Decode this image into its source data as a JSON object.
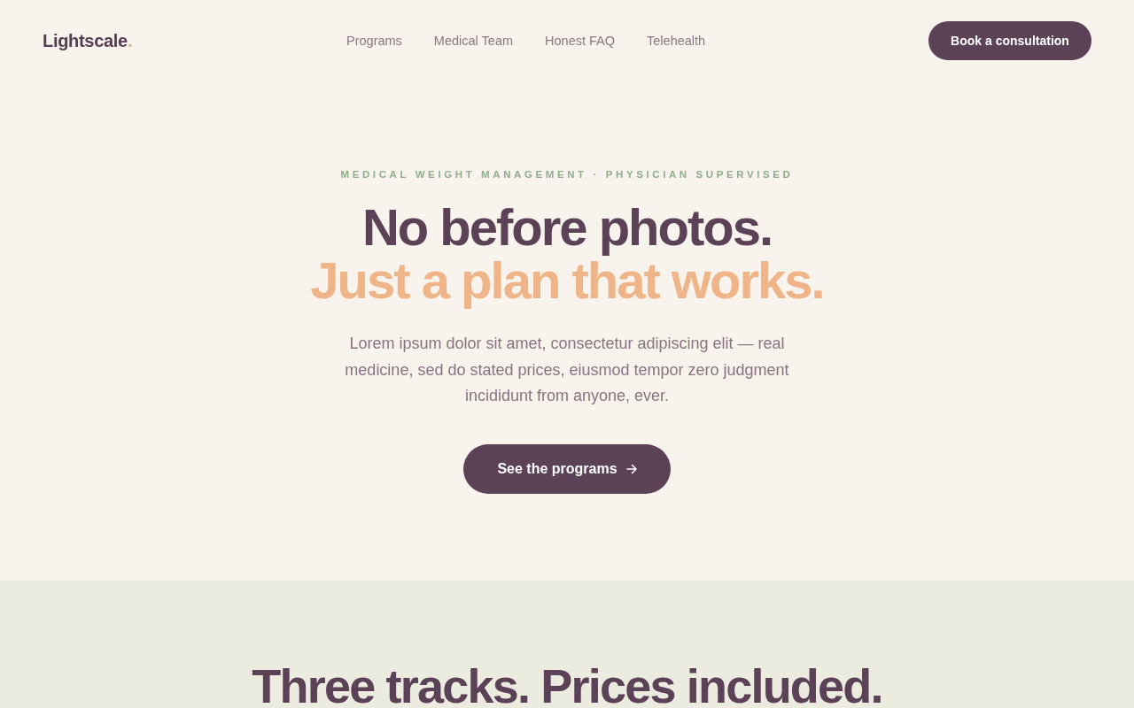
{
  "nav": {
    "logo": {
      "text": "Lightscale",
      "accent": "."
    },
    "links": [
      {
        "label": "Programs"
      },
      {
        "label": "Medical Team"
      },
      {
        "label": "Honest FAQ"
      },
      {
        "label": "Telehealth"
      }
    ],
    "cta": "Book a consultation"
  },
  "hero": {
    "eyebrow": "MEDICAL WEIGHT MANAGEMENT · PHYSICIAN SUPERVISED",
    "headline": [
      {
        "text": "No before photos.",
        "kind": "plain"
      },
      {
        "text": "Just a plan that works.",
        "kind": "accent"
      }
    ],
    "intro": "Lorem ipsum dolor sit amet, consectetur adipiscing elit — real medicine, sed do stated prices, eiusmod tempor zero judgment incididunt from anyone, ever.",
    "button": "See the programs"
  },
  "programs": {
    "heading": "Three tracks. Prices included."
  }
}
